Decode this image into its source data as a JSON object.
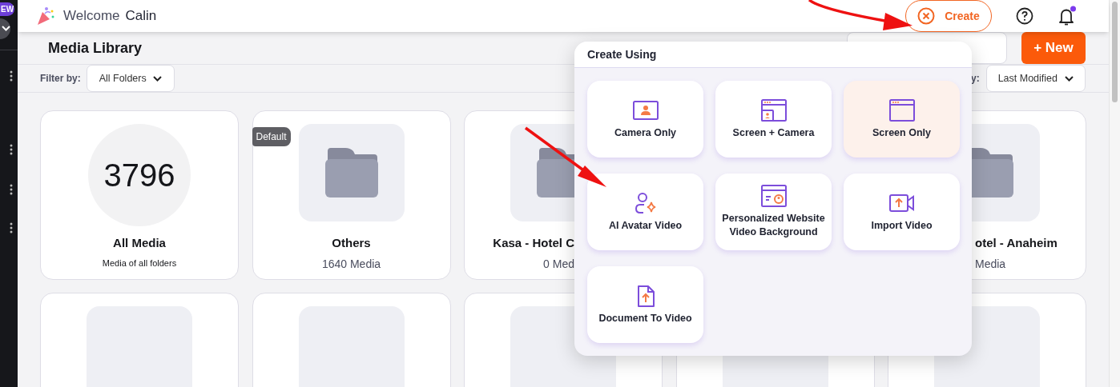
{
  "sidebar": {
    "badge": "EW"
  },
  "header": {
    "greeting": "Welcome",
    "user": "Calin",
    "create_button": "Create",
    "notifications_unread": true
  },
  "page": {
    "title": "Media Library",
    "new_button": "+ New"
  },
  "filters": {
    "label": "Filter by:",
    "folder": "All Folders",
    "sort_label": "y:",
    "sort": "Last Modified"
  },
  "folders": [
    {
      "kind": "count",
      "count": "3796",
      "title": "All Media",
      "subtitle": "Media of all folders"
    },
    {
      "kind": "folder",
      "badge": "Default",
      "title": "Others",
      "subtitle": "1640 Media"
    },
    {
      "kind": "cut_right",
      "title": "Kasa - Hotel C",
      "subtitle": "0 Med"
    },
    {
      "kind": "hidden"
    },
    {
      "kind": "cut_left",
      "title": "otel - Anaheim",
      "subtitle": "Media"
    }
  ],
  "create_menu": {
    "title": "Create Using",
    "options": [
      {
        "kind": "camera",
        "label": "Camera Only",
        "selected": false
      },
      {
        "kind": "screen_camera",
        "label": "Screen + Camera",
        "selected": false
      },
      {
        "kind": "screen",
        "label": "Screen Only",
        "selected": true
      },
      {
        "kind": "avatar",
        "label": "AI Avatar Video",
        "selected": false
      },
      {
        "kind": "website",
        "label": "Personalized Website Video Background",
        "selected": false
      },
      {
        "kind": "import",
        "label": "Import Video",
        "selected": false
      },
      {
        "kind": "document",
        "label": "Document To Video",
        "selected": false
      }
    ]
  }
}
